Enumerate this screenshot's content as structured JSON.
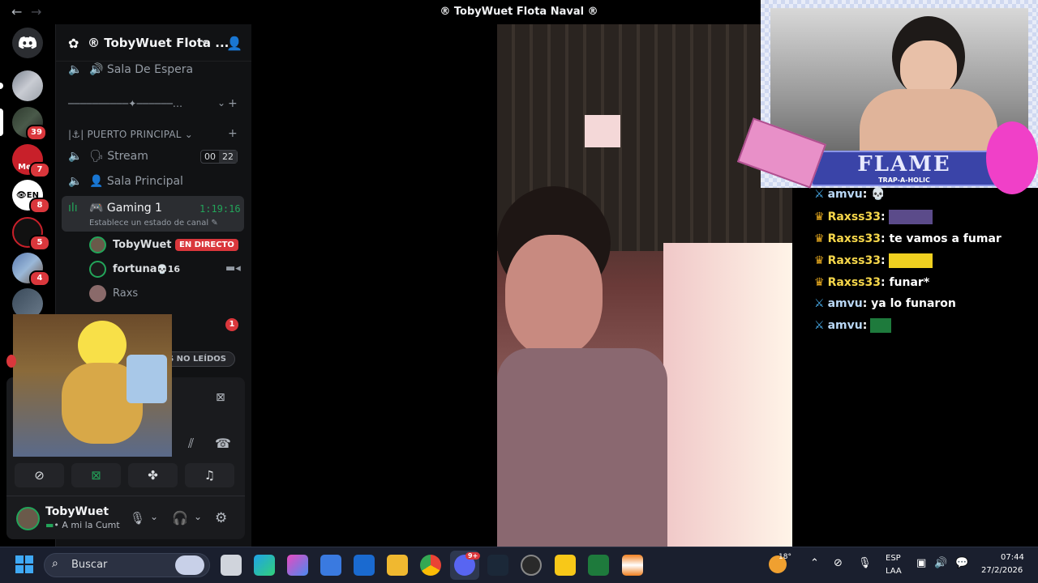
{
  "window": {
    "title": "® TobyWuet Flota Naval ®",
    "back": "←",
    "forward": "→"
  },
  "rail": {
    "badges": [
      "39",
      "7",
      "8",
      "5",
      "4"
    ],
    "srv_labels": [
      "Men",
      "EN"
    ]
  },
  "server": {
    "name": "® TobyWuet Flota ...",
    "chevron": "⌄"
  },
  "channels": {
    "waiting": "Sala De Espera",
    "divider": "──────────✦──────...",
    "category": "|⚓| PUERTO PRINCIPAL",
    "stream": "Stream",
    "stream_count_a": "00",
    "stream_count_b": "22",
    "main_room": "Sala Principal",
    "gaming": "Gaming 1",
    "gaming_time": "1:19:16",
    "gaming_status": "Establece un estado de canal",
    "users": [
      {
        "name": "TobyWuet",
        "badge": "EN DIRECTO"
      },
      {
        "name": "fortuna",
        "extra": "16"
      },
      {
        "name": "Raxs"
      }
    ],
    "unread_badge": "1",
    "unread_label": "S NO LEÍDOS"
  },
  "user_panel": {
    "name": "TobyWuet",
    "status": "• A mi la Cumt"
  },
  "chat": [
    {
      "nick": "amvu",
      "text": ": 💀",
      "color": "#b9d7f5"
    },
    {
      "nick": "Raxss33",
      "text": ":",
      "color": "#f5d64a",
      "emote": "#5b4b8a"
    },
    {
      "nick": "Raxss33",
      "text": ": te vamos a fumar",
      "color": "#f5d64a"
    },
    {
      "nick": "Raxss33",
      "text": ":",
      "color": "#f5d64a",
      "emote": "#f0d020"
    },
    {
      "nick": "Raxss33",
      "text": ": funar*",
      "color": "#f5d64a"
    },
    {
      "nick": "amvu",
      "text": ": ya lo funaron",
      "color": "#b9d7f5"
    },
    {
      "nick": "amvu",
      "text": ":",
      "color": "#b9d7f5",
      "emote": "#1e7a3c"
    }
  ],
  "overlay": {
    "brand": "FLAME",
    "sub": "TRAP-A-HOLIC"
  },
  "taskbar": {
    "search": "Buscar",
    "temp": "18°",
    "lang_a": "ESP",
    "lang_b": "LAA",
    "time": "07:44",
    "date": "27/2/2026",
    "discord_badge": "9+"
  },
  "colors": {
    "live": "#da373c",
    "accent": "#23a55a",
    "blurple": "#5865f2"
  }
}
